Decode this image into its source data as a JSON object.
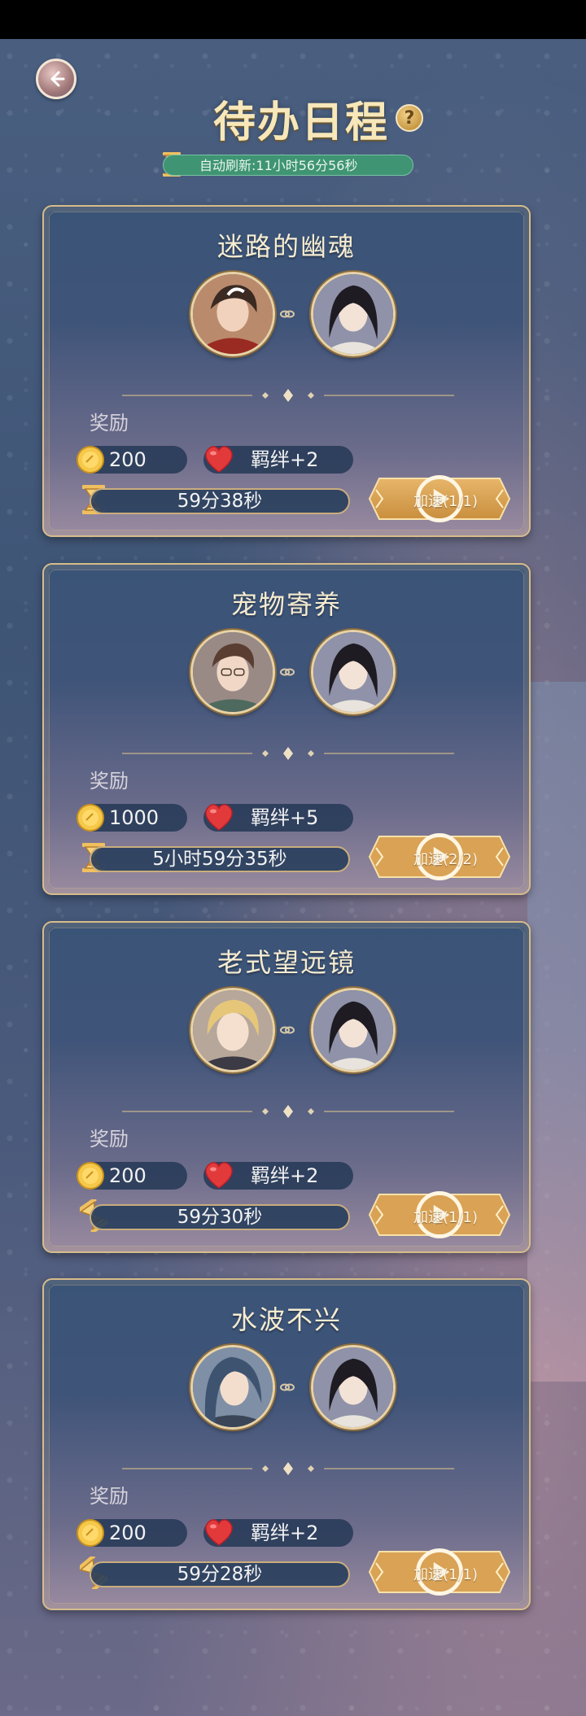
{
  "header": {
    "title": "待办日程",
    "help": "?",
    "refresh": "自动刷新:11小时56分56秒"
  },
  "reward_label": "奖励",
  "tasks": [
    {
      "title": "迷路的幽魂",
      "coins": "200",
      "bond": "羁绊+2",
      "timer": "59分38秒",
      "speed": "加速(1/1)"
    },
    {
      "title": "宠物寄养",
      "coins": "1000",
      "bond": "羁绊+5",
      "timer": "5小时59分35秒",
      "speed": "加速(2/2)"
    },
    {
      "title": "老式望远镜",
      "coins": "200",
      "bond": "羁绊+2",
      "timer": "59分30秒",
      "speed": "加速(1/1)"
    },
    {
      "title": "水波不兴",
      "coins": "200",
      "bond": "羁绊+2",
      "timer": "59分28秒",
      "speed": "加速(1/1)"
    }
  ],
  "colors": {
    "accent_gold": "#d6bc8b",
    "title_gold": "#f7e7b9",
    "refresh_green": "#3f9473",
    "heart_red": "#e23a3a"
  }
}
